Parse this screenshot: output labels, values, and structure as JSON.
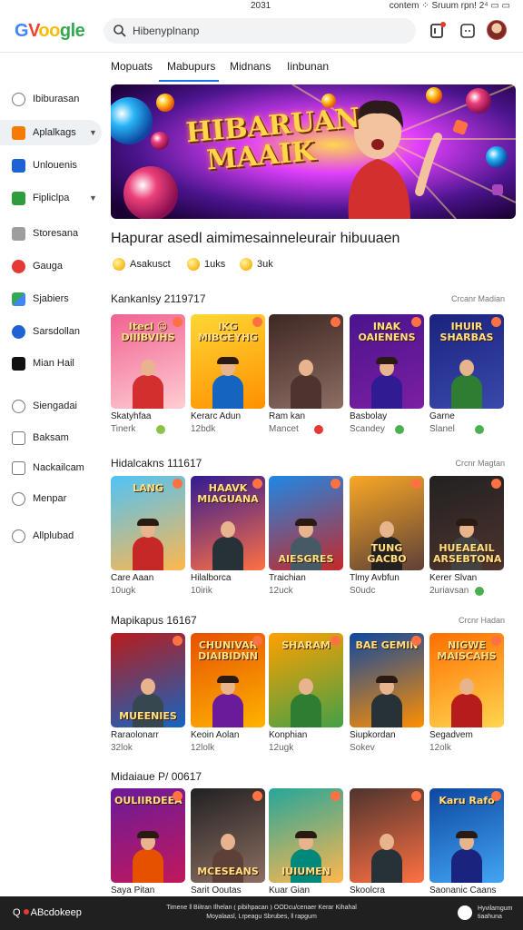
{
  "status_bar": {
    "time": "2031",
    "right_text": "contem ⁘ Sruum rpn! 2⁴ ▭ ▭"
  },
  "brand": {
    "logo_parts": [
      "G",
      "V",
      "oo",
      "gle"
    ]
  },
  "search": {
    "value": "Hibenyplnanp",
    "icon": "search-icon"
  },
  "toolbar": {
    "icons": [
      "notifications-icon",
      "window-icon",
      "account-avatar"
    ]
  },
  "tabs": [
    {
      "label": "Mopuats",
      "selected": false
    },
    {
      "label": "Mabupurs",
      "selected": true
    },
    {
      "label": "Midnans",
      "selected": false
    },
    {
      "label": "Iinbunan",
      "selected": false
    }
  ],
  "sidebar": {
    "items": [
      {
        "label": "Ibiburasan",
        "icon": "search-icon",
        "color": "#777777",
        "active": false,
        "expandable": false
      },
      {
        "label": "Aplalkags",
        "icon": "apps-icon",
        "color": "#f57c00",
        "active": true,
        "expandable": true
      },
      {
        "label": "Unlouenis",
        "icon": "bookmark-icon",
        "color": "#1e63d6",
        "active": false,
        "expandable": false
      },
      {
        "label": "Fipliclpa",
        "icon": "folder-icon",
        "color": "#2e9b3c",
        "active": false,
        "expandable": true
      },
      {
        "label": "Storesana",
        "icon": "store-icon",
        "color": "#666666",
        "active": false,
        "expandable": false
      },
      {
        "label": "Gauga",
        "icon": "gauge-icon",
        "color": "#e53935",
        "active": false,
        "expandable": false
      },
      {
        "label": "Sjabiers",
        "icon": "shapes-icon",
        "color": "#34a853",
        "active": false,
        "expandable": false
      },
      {
        "label": "Sarsdollan",
        "icon": "dollar-icon",
        "color": "#1e63d6",
        "active": false,
        "expandable": false
      },
      {
        "label": "Mian Hail",
        "icon": "mail-icon",
        "color": "#111111",
        "active": false,
        "expandable": false
      },
      {
        "label": "Siengadai",
        "icon": "clock-icon",
        "color": "#777777",
        "active": false,
        "expandable": false
      },
      {
        "label": "Baksam",
        "icon": "grid-icon",
        "color": "#777777",
        "active": false,
        "expandable": false
      },
      {
        "label": "Nackailcam",
        "icon": "home-icon",
        "color": "#777777",
        "active": false,
        "expandable": false
      },
      {
        "label": "Menpar",
        "icon": "person-icon",
        "color": "#777777",
        "active": false,
        "expandable": false
      },
      {
        "label": "Allplubad",
        "icon": "circle-icon",
        "color": "#777777",
        "active": false,
        "expandable": false
      }
    ]
  },
  "banner": {
    "title_line1": "HIBARUAN",
    "title_line2": "MAAIK"
  },
  "headline": "Hapurar asedl aimimesainneleurair hibuuaen",
  "chips": [
    {
      "label": "Asakusct"
    },
    {
      "label": "1uks"
    },
    {
      "label": "3uk"
    }
  ],
  "sections": [
    {
      "title": "Kankanlsy 2119717",
      "more": "Crcanr Madian",
      "cards": [
        {
          "art_text": "Itecl ☺ DIIIBVIHS",
          "title": "Skatyhfaa",
          "sub": "Tinerk",
          "bg1": "#f06292",
          "bg2": "#ffcdd2",
          "body": "#d32f2f",
          "extra_color": "#8bc34a"
        },
        {
          "art_text": "IKG MIBGEYHG",
          "title": "Kerarc Adun",
          "sub": "12bdk",
          "bg1": "#fdd835",
          "bg2": "#ff8f00",
          "body": "#1565c0",
          "extra_color": ""
        },
        {
          "art_text": "",
          "title": "Ram kan",
          "sub": "Mancet",
          "bg1": "#3e2723",
          "bg2": "#8d6e63",
          "body": "#4e342e",
          "extra_color": "#e53935"
        },
        {
          "art_text": "INAK OAIENENS",
          "title": "Basbolay",
          "sub": "Scandey",
          "bg1": "#4a148c",
          "bg2": "#7b1fa2",
          "body": "#311b92",
          "extra_color": "#4caf50"
        },
        {
          "art_text": "IHUIR SHARBAS",
          "title": "Garne",
          "sub": "Slanel",
          "bg1": "#1a237e",
          "bg2": "#3949ab",
          "body": "#2e7d32",
          "extra_color": "#4caf50"
        }
      ]
    },
    {
      "title": "Hidalcakns 111617",
      "more": "Crcnr Magtan",
      "cards": [
        {
          "art_text": "LANG",
          "title": "Care Aaan",
          "sub": "10ugk",
          "bg1": "#4fc3f7",
          "bg2": "#ffb74d",
          "body": "#c62828",
          "extra_color": ""
        },
        {
          "art_text": "HAAVK MIAGUANA",
          "title": "Hilalborca",
          "sub": "10irik",
          "bg1": "#311b92",
          "bg2": "#ff7043",
          "body": "#263238",
          "extra_color": ""
        },
        {
          "art_text": "AIESGRES",
          "title": "Traichian",
          "sub": "12uck",
          "bg1": "#1e88e5",
          "bg2": "#c62828",
          "body": "#455a64",
          "extra_color": ""
        },
        {
          "art_text": "TUNG GACBO",
          "title": "Tlmy Avbfun",
          "sub": "S0udc",
          "bg1": "#f9a825",
          "bg2": "#5d4037",
          "body": "#212121",
          "extra_color": ""
        },
        {
          "art_text": "HUEAEAIL ARSEBTONA",
          "title": "Kerer Slvan",
          "sub": "2uriavsan",
          "bg1": "#212121",
          "bg2": "#4e342e",
          "body": "#424242",
          "extra_color": "#4caf50"
        }
      ]
    },
    {
      "title": "Mapikapus 16167",
      "more": "Crcnr Hadan",
      "cards": [
        {
          "art_text": "MUEENIES",
          "title": "Raraolonarr",
          "sub": "32lok",
          "bg1": "#b71c1c",
          "bg2": "#1565c0",
          "body": "#37474f",
          "extra_color": ""
        },
        {
          "art_text": "CHUNIVAR DIAIBIDNN",
          "title": "Keoin Aolan",
          "sub": "12lolk",
          "bg1": "#e65100",
          "bg2": "#ffb300",
          "body": "#6a1b9a",
          "extra_color": ""
        },
        {
          "art_text": "SHARAM",
          "title": "Konphian",
          "sub": "12ugk",
          "bg1": "#ffa000",
          "bg2": "#43a047",
          "body": "#2e7d32",
          "extra_color": ""
        },
        {
          "art_text": "BAE GEMIN",
          "title": "Siupkordan",
          "sub": "Sokev",
          "bg1": "#0d47a1",
          "bg2": "#ff8f00",
          "body": "#263238",
          "extra_color": ""
        },
        {
          "art_text": "NIGWE MAISCAHS",
          "title": "Segadvem",
          "sub": "12olk",
          "bg1": "#ff6f00",
          "bg2": "#ffd54f",
          "body": "#b71c1c",
          "extra_color": ""
        }
      ]
    },
    {
      "title": "Midaiaue P/ 00617",
      "more": "",
      "cards": [
        {
          "art_text": "OULIIRDEEA",
          "title": "Saya Pitan",
          "sub": "",
          "bg1": "#6a1b9a",
          "bg2": "#c2185b",
          "body": "#e65100",
          "extra_color": ""
        },
        {
          "art_text": "MCESEANS",
          "title": "Sarit Ooutas",
          "sub": "",
          "bg1": "#212121",
          "bg2": "#8d6e63",
          "body": "#5d4037",
          "extra_color": ""
        },
        {
          "art_text": "IUIUMEN",
          "title": "Kuar Gian",
          "sub": "",
          "bg1": "#26a69a",
          "bg2": "#ffb74d",
          "body": "#00897b",
          "extra_color": ""
        },
        {
          "art_text": "",
          "title": "Skoolcra",
          "sub": "",
          "bg1": "#4e342e",
          "bg2": "#ff7043",
          "body": "#263238",
          "extra_color": ""
        },
        {
          "art_text": "Karu Rafo",
          "title": "Saonanic Caans",
          "sub": "",
          "bg1": "#0d47a1",
          "bg2": "#42a5f5",
          "body": "#1a237e",
          "extra_color": ""
        }
      ]
    }
  ],
  "footer": {
    "left_label": "ABcdokeep",
    "mid_line1": "Timene ‖ Biitran Ilhelan ⦅ pibihpacan ⦆ OODcu/cenaer Kerar Kihahal",
    "mid_line2": "Moyalaasl, Lrpeagu Sbrubes, ‖ rapgum",
    "right_line1": "Hyvilamgum",
    "right_line2": "tiaahuna"
  }
}
